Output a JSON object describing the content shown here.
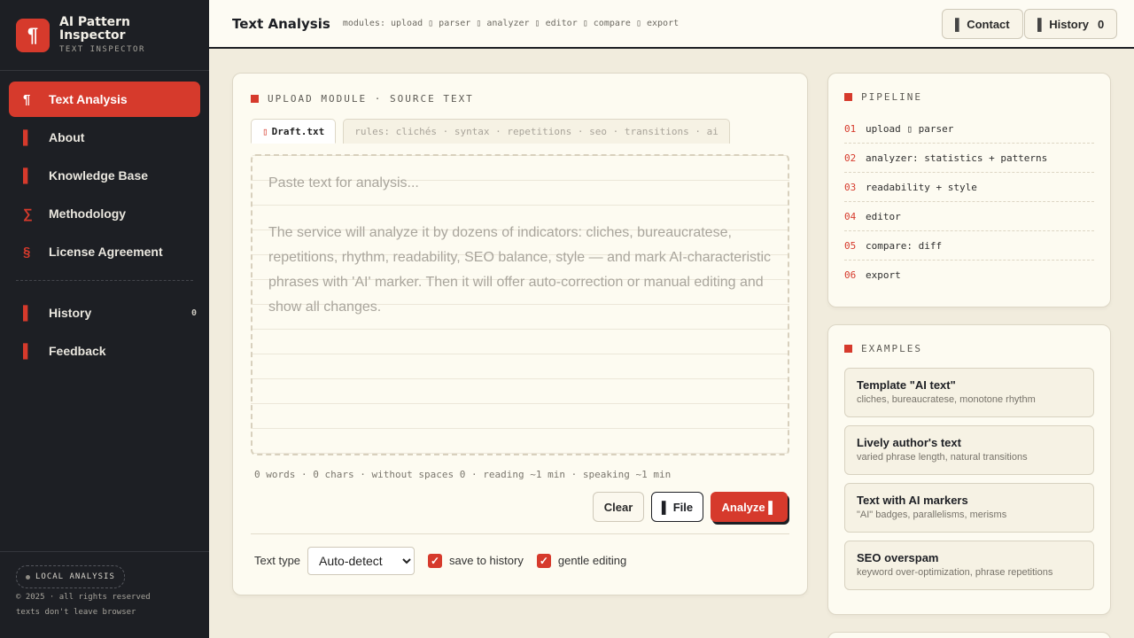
{
  "brand": {
    "logo_glyph": "¶",
    "title": "AI Pattern Inspector",
    "subtitle": "TEXT INSPECTOR"
  },
  "sidebar": {
    "items": [
      {
        "icon": "¶",
        "icon_name": "pilcrow-icon",
        "label": "Text Analysis",
        "active": true
      },
      {
        "icon": "▌",
        "icon_name": "info-icon",
        "label": "About"
      },
      {
        "icon": "▌",
        "icon_name": "book-icon",
        "label": "Knowledge Base"
      },
      {
        "icon": "∑",
        "icon_name": "sigma-icon",
        "label": "Methodology"
      },
      {
        "icon": "§",
        "icon_name": "section-icon",
        "label": "License Agreement"
      }
    ],
    "secondary": [
      {
        "icon": "▌",
        "icon_name": "history-icon",
        "label": "History",
        "count": "0"
      },
      {
        "icon": "▌",
        "icon_name": "feedback-icon",
        "label": "Feedback"
      }
    ],
    "footer": {
      "badge": "LOCAL ANALYSIS",
      "line1": "© 2025 · all rights reserved",
      "line2": "texts don't leave browser"
    }
  },
  "header": {
    "title": "Text Analysis",
    "modules": "modules: upload ▯ parser ▯ analyzer ▯ editor ▯ compare ▯ export",
    "contact_icon": "▌",
    "contact_label": "Contact",
    "history_icon": "▌",
    "history_label": "History",
    "history_count": "0"
  },
  "main": {
    "section_label": "UPLOAD MODULE · SOURCE TEXT",
    "tab_icon": "▯",
    "tab_file": "Draft.txt",
    "tab_rules": "rules: clichés · syntax · repetitions · seo · transitions · ai",
    "placeholder_p1": "Paste text for analysis...",
    "placeholder_p2": "The service will analyze it by dozens of indicators: cliches, bureaucratese, repetitions, rhythm, readability, SEO balance, style — and mark AI-characteristic phrases with 'AI' marker. Then it will offer auto-correction or manual editing and show all changes.",
    "stats": "0 words · 0 chars · without spaces 0 · reading ~1 min · speaking ~1 min",
    "btn_clear": "Clear",
    "btn_file": "▌ File",
    "btn_analyze": "Analyze ▌",
    "text_type_label": "Text type",
    "text_type_value": "Auto-detect",
    "save_history": "save to history",
    "gentle_editing": "gentle editing"
  },
  "pipeline": {
    "label": "PIPELINE",
    "steps": [
      {
        "num": "01",
        "text": "upload ▯ parser"
      },
      {
        "num": "02",
        "text": "analyzer: statistics + patterns"
      },
      {
        "num": "03",
        "text": "readability + style"
      },
      {
        "num": "04",
        "text": "editor"
      },
      {
        "num": "05",
        "text": "compare: diff"
      },
      {
        "num": "06",
        "text": "export"
      }
    ]
  },
  "examples": {
    "label": "EXAMPLES",
    "items": [
      {
        "title": "Template \"AI text\"",
        "desc": "cliches, bureaucratese, monotone rhythm"
      },
      {
        "title": "Lively author's text",
        "desc": "varied phrase length, natural transitions"
      },
      {
        "title": "Text with AI markers",
        "desc": "\"AI\" badges, parallelisms, merisms"
      },
      {
        "title": "SEO overspam",
        "desc": "keyword over-optimization, phrase repetitions"
      }
    ]
  },
  "colors": {
    "accent": "#d63a2c",
    "sidebar_bg": "#1d1f24",
    "page_bg": "#f1ecdd",
    "card_bg": "#fdfbf1"
  }
}
